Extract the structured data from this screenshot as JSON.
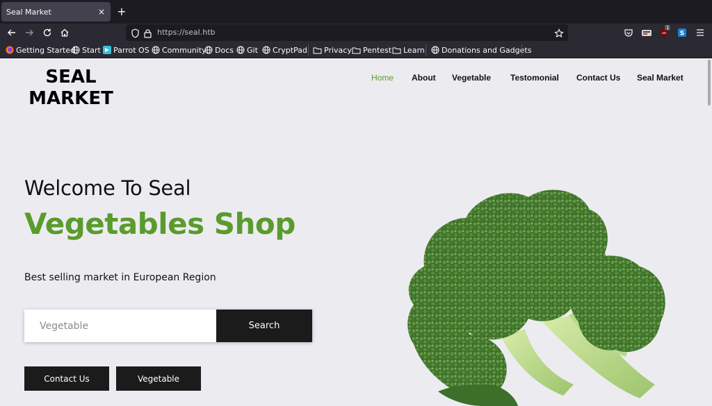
{
  "browser": {
    "tab": {
      "title": "Seal Market",
      "close": "×"
    },
    "new_tab": "+",
    "url": "https://seal.htb",
    "bookmarks": [
      {
        "label": "Getting Started",
        "icon": "firefox-icon"
      },
      {
        "label": "Start",
        "icon": "globe-icon"
      },
      {
        "label": "Parrot OS",
        "icon": "parrot-icon"
      },
      {
        "label": "Community",
        "icon": "globe-icon"
      },
      {
        "label": "Docs",
        "icon": "globe-icon"
      },
      {
        "label": "Git",
        "icon": "globe-icon"
      },
      {
        "label": "CryptPad",
        "icon": "globe-icon"
      },
      {
        "label": "Privacy",
        "icon": "folder-icon"
      },
      {
        "label": "Pentest",
        "icon": "folder-icon"
      },
      {
        "label": "Learn",
        "icon": "folder-icon"
      },
      {
        "label": "Donations and Gadgets",
        "icon": "globe-icon"
      }
    ],
    "extension_badge": "1"
  },
  "site": {
    "logo_line1": "SEAL",
    "logo_line2": "MARKET",
    "nav": [
      "Home",
      "About",
      "Vegetable",
      "Testomonial",
      "Contact Us",
      "Seal Market"
    ],
    "nav_active": "Home",
    "hero": {
      "welcome": "Welcome To Seal",
      "headline": "Vegetables Shop",
      "tagline": "Best selling market in European Region"
    },
    "search": {
      "placeholder": "Vegetable",
      "button": "Search"
    },
    "buttons": {
      "contact": "Contact Us",
      "vegetable": "Vegetable"
    }
  },
  "colors": {
    "accent": "#5a9b2d",
    "dark": "#1b1b1b",
    "page_bg": "#ececf0"
  }
}
